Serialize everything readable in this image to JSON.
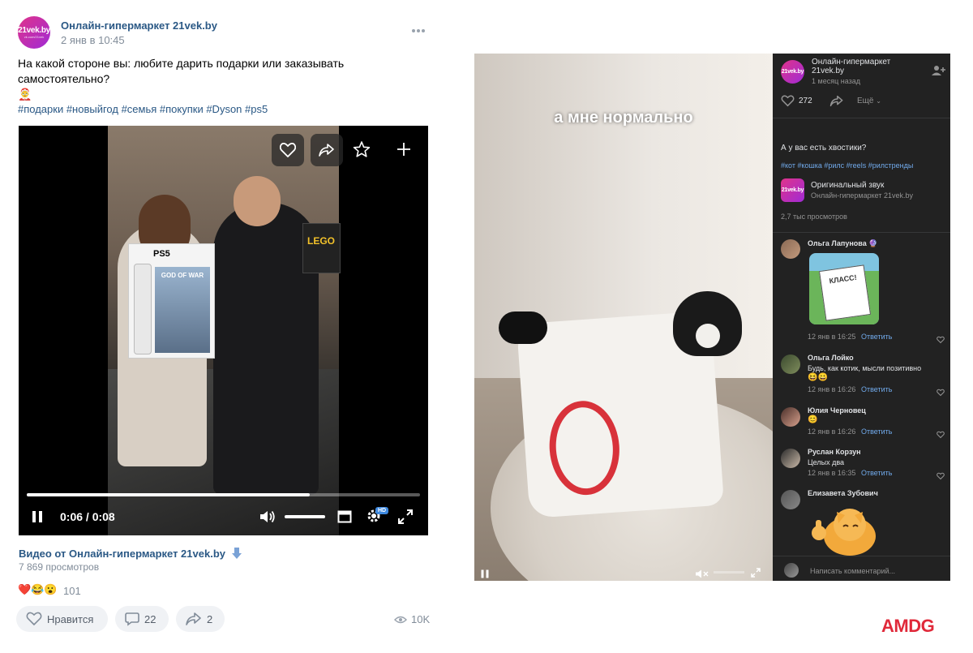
{
  "post": {
    "author": "Онлайн-гипермаркет 21vek.by",
    "avatar_brand": "21vek.by",
    "avatar_sub": "vk.com/21vek",
    "date": "2 янв в 10:45",
    "more_icon": "more-horizontal-icon",
    "text": "На какой стороне вы: любите дарить подарки или заказывать самостоятельно?",
    "emoji": "🤶",
    "tags": "#подарки #новыйгод #семья #покупки #Dyson #ps5",
    "video": {
      "time": "0:06 / 0:08",
      "progress": 0.72,
      "volume": 1.0,
      "hd_badge": "HD",
      "box_brand": "PS5",
      "box_title": "GOD OF WAR",
      "sign_text": "LEGO"
    },
    "video_title": "Видео от Онлайн-гипермаркет 21vek.by",
    "views": "7 869 просмотров",
    "reactions_emoji": "❤️😂😮",
    "reactions_count": "101",
    "like_label": "Нравится",
    "comments_count": "22",
    "shares_count": "2",
    "views_short": "10K"
  },
  "reel": {
    "caption_overlay": "а мне нормально",
    "author": "Онлайн-гипермаркет 21vek.by",
    "avatar_brand": "21vek.by",
    "time_ago": "1 месяц назад",
    "likes": "272",
    "more_label": "Ещё",
    "text": "А у вас есть хвостики?",
    "tags": "#кот #кошка #рилс #reels #рилстренды",
    "sound_title": "Оригинальный звук",
    "sound_author": "Онлайн-гипермаркет 21vek.by",
    "views": "2,7 тыс просмотров",
    "comment_placeholder": "Написать комментарий...",
    "progress": 0.0,
    "comments": [
      {
        "name": "Ольга Лапунова",
        "badge": "🔮",
        "text": "",
        "sticker": "КЛАСС!",
        "date": "12 янв в 16:25",
        "reply": "Ответить"
      },
      {
        "name": "Ольга Лойко",
        "badge": "",
        "text": "Будь, как котик, мысли позитивно",
        "emoji": "😆😀",
        "date": "12 янв в 16:26",
        "reply": "Ответить"
      },
      {
        "name": "Юлия Черновец",
        "badge": "",
        "text": "",
        "emoji": "😊",
        "date": "12 янв в 16:26",
        "reply": "Ответить"
      },
      {
        "name": "Руслан Корзун",
        "badge": "",
        "text": "Целых два",
        "emoji": "",
        "date": "12 янв в 16:35",
        "reply": "Ответить"
      },
      {
        "name": "Елизавета Зубович",
        "badge": "",
        "text": "",
        "emoji": "",
        "date": "",
        "reply": ""
      }
    ]
  },
  "watermark": "AMDG",
  "colors": {
    "link": "#2a5885",
    "accent": "#e0338a",
    "watermark": "#e0293a",
    "dark_bg": "#222222"
  }
}
